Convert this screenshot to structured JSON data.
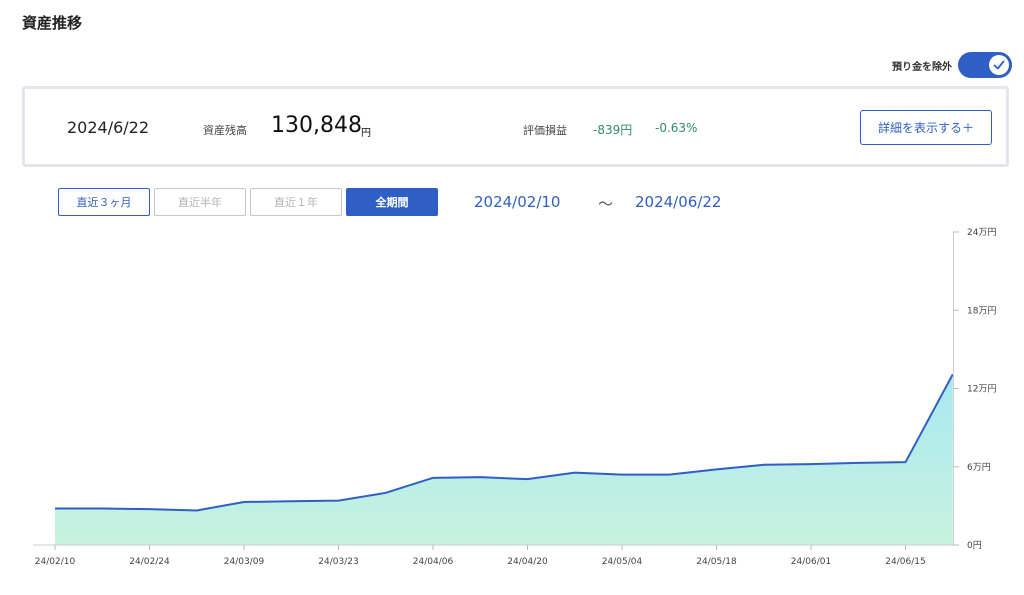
{
  "page": {
    "title": "資産推移"
  },
  "toggle": {
    "label": "預り金を除外",
    "checked": true
  },
  "summary": {
    "date": "2024/6/22",
    "balance_label": "資産残高",
    "balance_value": "130,848",
    "balance_unit": "円",
    "pl_label": "評価損益",
    "pl_amount": "-839円",
    "pl_percent": "-0.63%",
    "detail_button": "詳細を表示する＋"
  },
  "periods": [
    {
      "label": "直近３ヶ月",
      "state": "enabled"
    },
    {
      "label": "直近半年",
      "state": "disabled"
    },
    {
      "label": "直近１年",
      "state": "disabled"
    },
    {
      "label": "全期間",
      "state": "active"
    }
  ],
  "range": {
    "start": "2024/02/10",
    "separator": "〜",
    "end": "2024/06/22"
  },
  "colors": {
    "accent": "#2f5fc4",
    "positive_text": "#2e8b6d",
    "line": "#2f5fc4",
    "area_top": "#a8e8f2",
    "area_bottom": "#c8f2de"
  },
  "chart_data": {
    "type": "area",
    "x_tick_labels": [
      "24/02/10",
      "24/02/24",
      "24/03/09",
      "24/03/23",
      "24/04/06",
      "24/04/20",
      "24/05/04",
      "24/05/18",
      "24/06/01",
      "24/06/15"
    ],
    "y_tick_labels": [
      "24万円",
      "18万円",
      "12万円",
      "6万円",
      "0円"
    ],
    "y_tick_values": [
      240000,
      180000,
      120000,
      60000,
      0
    ],
    "ylim": [
      0,
      240000
    ],
    "series": [
      {
        "x": [
          "2024-02-10",
          "2024-02-17",
          "2024-02-24",
          "2024-03-02",
          "2024-03-09",
          "2024-03-16",
          "2024-03-23",
          "2024-03-30",
          "2024-04-06",
          "2024-04-13",
          "2024-04-20",
          "2024-04-27",
          "2024-05-04",
          "2024-05-11",
          "2024-05-18",
          "2024-05-25",
          "2024-06-01",
          "2024-06-08",
          "2024-06-15",
          "2024-06-22"
        ],
        "values": [
          28000,
          28000,
          27500,
          26500,
          33000,
          33500,
          34000,
          40000,
          51500,
          52000,
          50500,
          55500,
          54000,
          54000,
          58000,
          61500,
          62000,
          63000,
          63500,
          130848
        ]
      }
    ],
    "grid": false
  }
}
